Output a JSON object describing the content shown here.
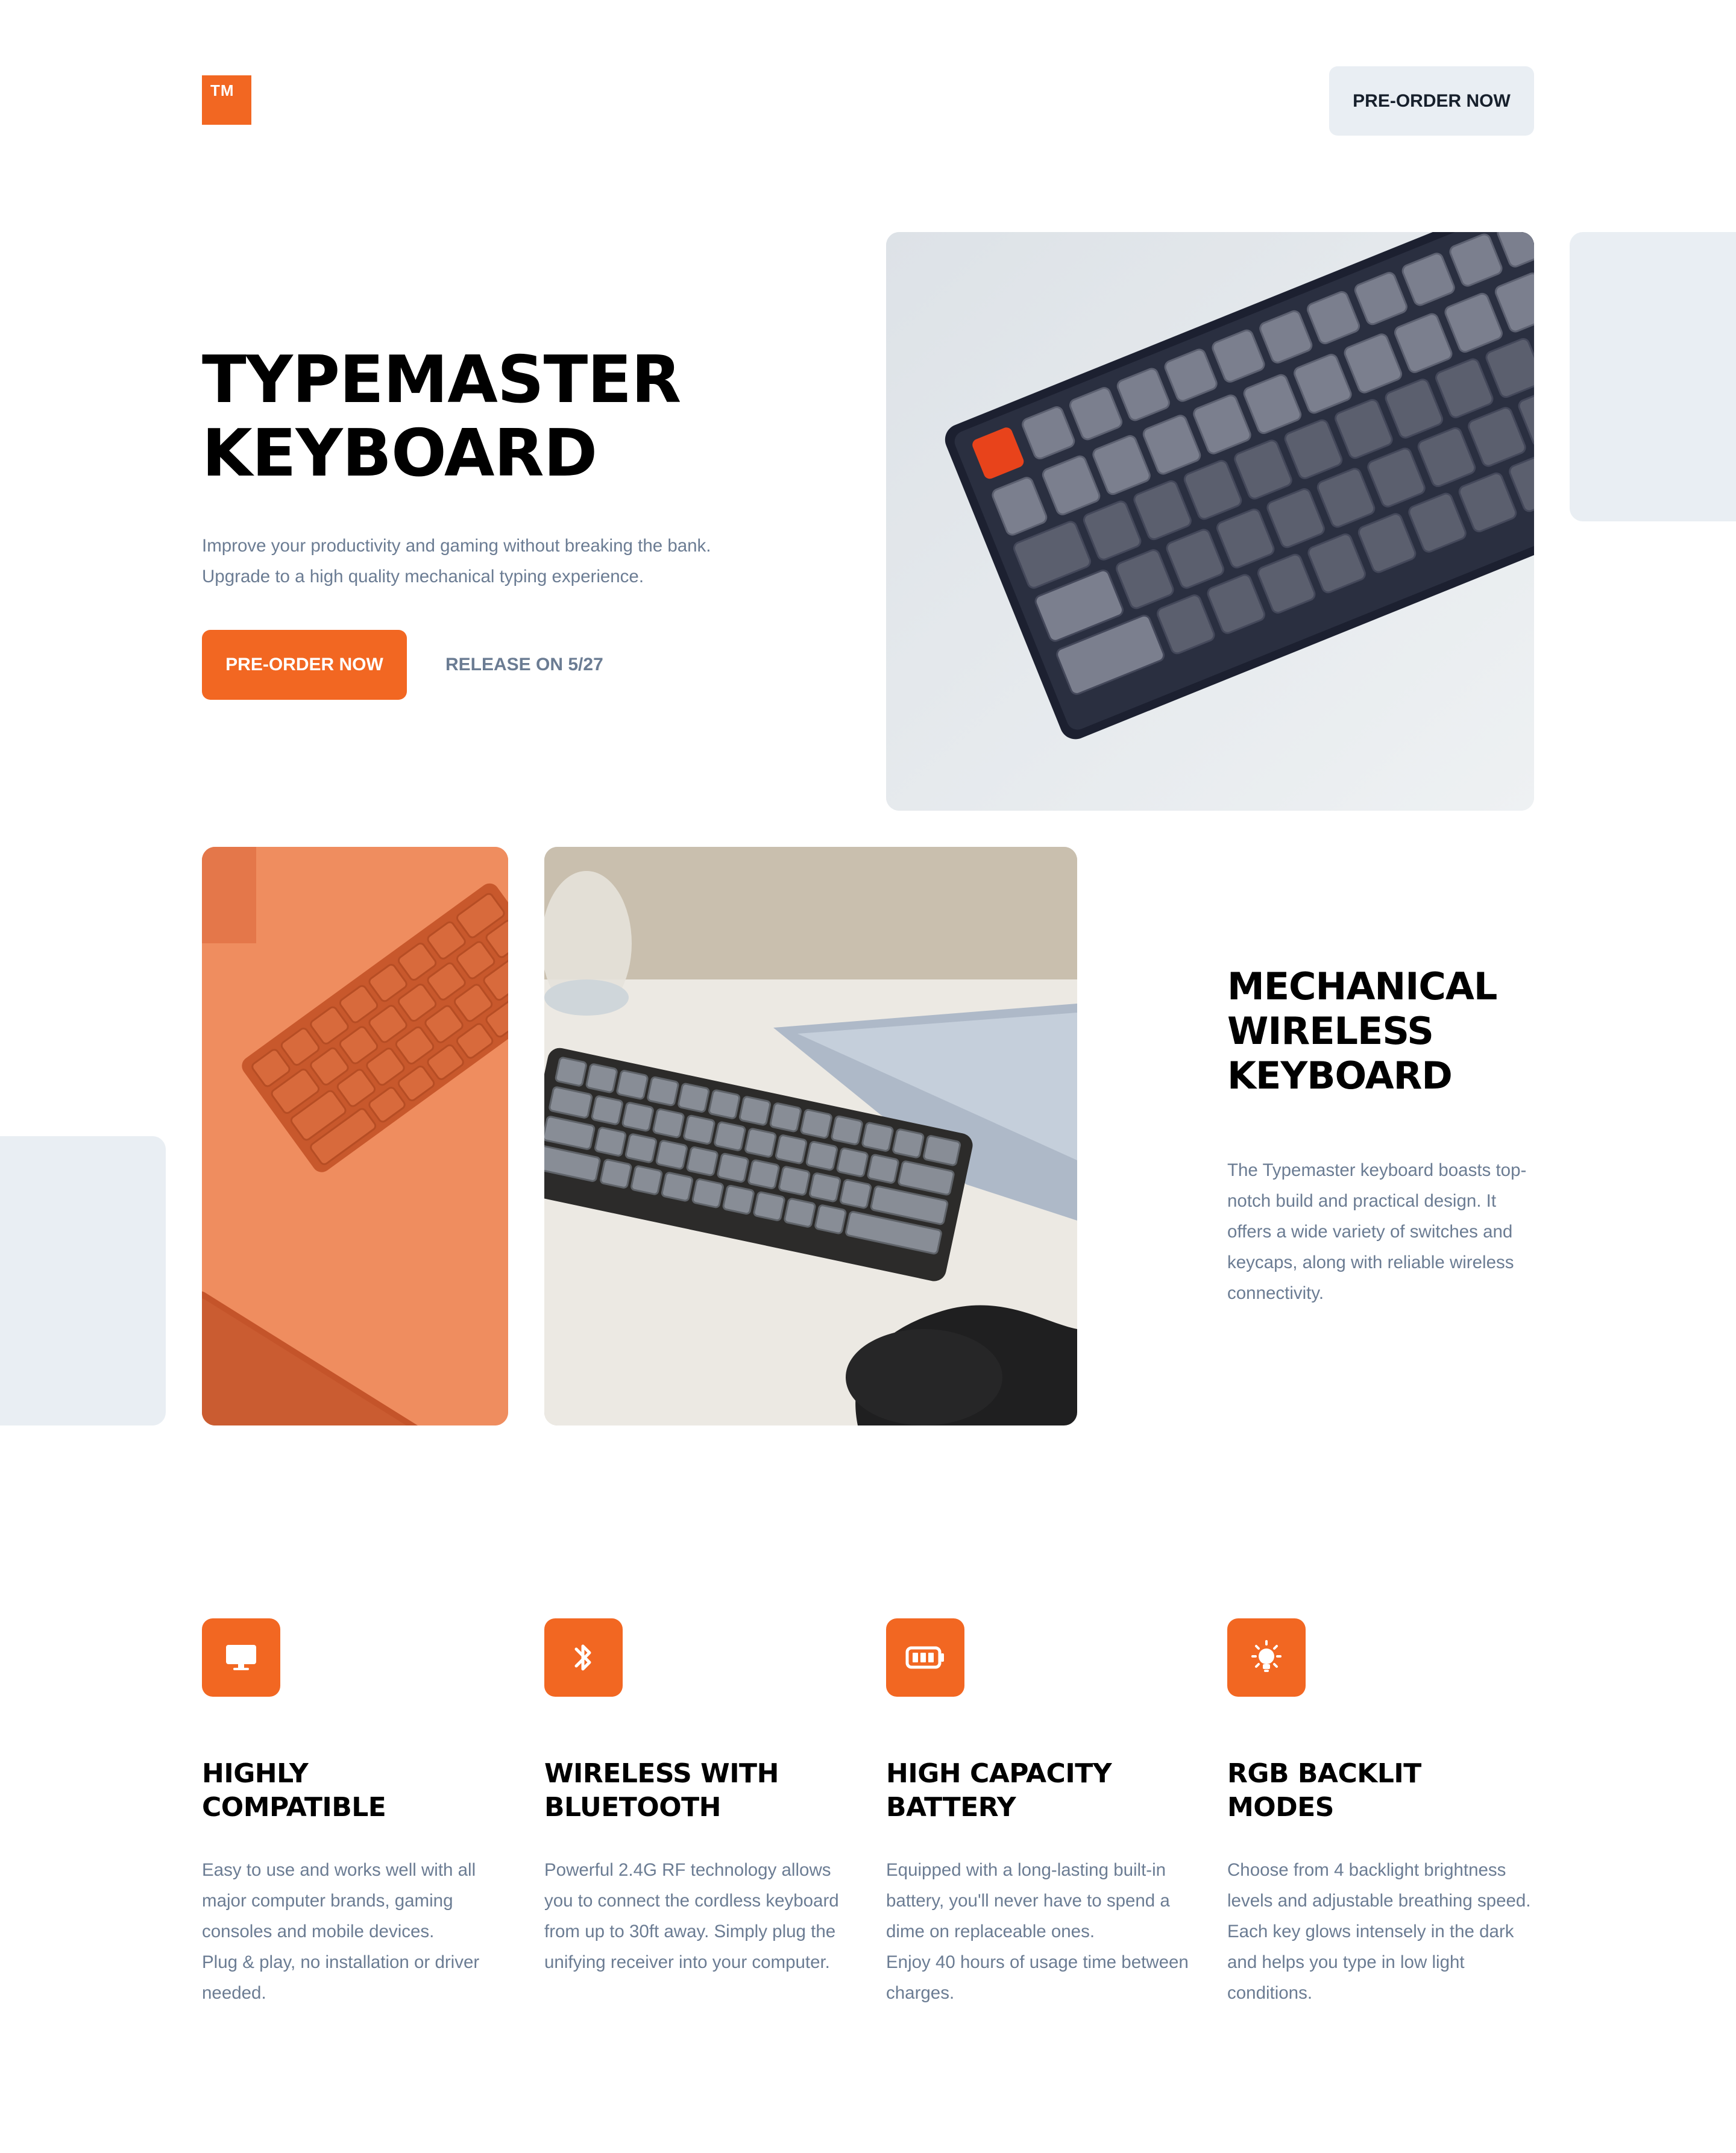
{
  "header": {
    "logo_text": "TM",
    "cta_label": "PRE-ORDER NOW"
  },
  "hero": {
    "title": "TYPEMASTER\nKEYBOARD",
    "description": "Improve your productivity and gaming without breaking the bank. Upgrade to a high quality mechanical typing experience.",
    "cta_label": "PRE-ORDER NOW",
    "release_text": "RELEASE ON 5/27"
  },
  "showcase": {
    "title": "MECHANICAL\nWIRELESS\nKEYBOARD",
    "description": "The Typemaster keyboard boasts top-notch build and practical design. It offers a wide variety of switches and keycaps, along with reliable wireless connectivity."
  },
  "features": [
    {
      "icon": "monitor-icon",
      "title": "HIGHLY\nCOMPATIBLE",
      "description": "Easy to use and works well with all major computer brands, gaming consoles and mobile devices.\nPlug & play, no installation or driver needed."
    },
    {
      "icon": "bluetooth-icon",
      "title": "WIRELESS WITH\nBLUETOOTH",
      "description": "Powerful 2.4G RF technology allows you to connect the cordless keyboard from up to 30ft away. Simply plug the unifying receiver into your computer."
    },
    {
      "icon": "battery-icon",
      "title": "HIGH CAPACITY\nBATTERY",
      "description": "Equipped with a long-lasting built-in battery, you'll never have to spend a dime on replaceable ones.\nEnjoy 40 hours of usage time between charges."
    },
    {
      "icon": "lightbulb-icon",
      "title": "RGB BACKLIT\nMODES",
      "description": "Choose from 4 backlight brightness levels and adjustable breathing speed. Each key glows intensely in the dark and helps you type in low light conditions."
    }
  ],
  "colors": {
    "accent": "#f26722",
    "muted_text": "#6b7c93",
    "block_gray": "#e9eef3"
  }
}
